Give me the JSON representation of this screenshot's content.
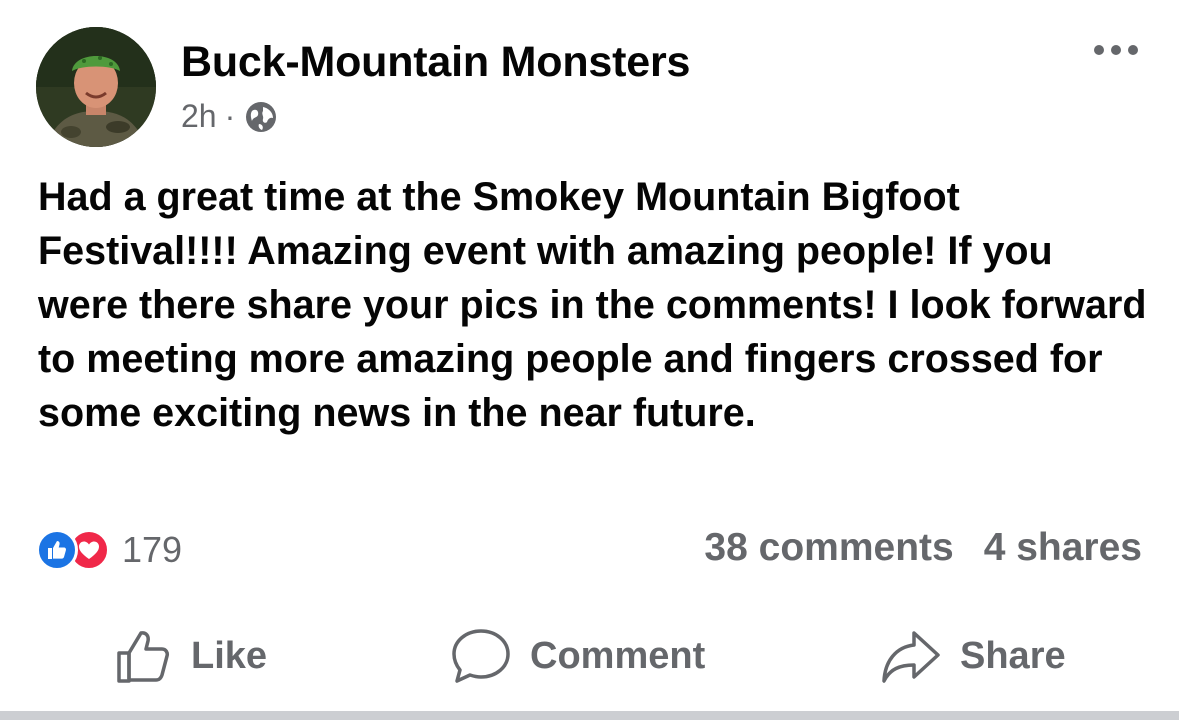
{
  "post": {
    "author": "Buck-Mountain Monsters",
    "time": "2h",
    "separator": "·",
    "audience_icon": "globe-icon",
    "body": "Had a great time at the Smokey Mountain Bigfoot Festival!!!! Amazing event with amazing people! If you were there share your pics in the comments! I look forward to meeting more amazing people and fingers crossed for some exciting news in the near future.",
    "reaction_count": "179",
    "comments": "38 comments",
    "shares": "4 shares"
  },
  "actions": {
    "like": "Like",
    "comment": "Comment",
    "share": "Share"
  },
  "colors": {
    "like_blue": "#1b74e4",
    "love_red": "#f02849",
    "secondary_text": "#65676b"
  }
}
